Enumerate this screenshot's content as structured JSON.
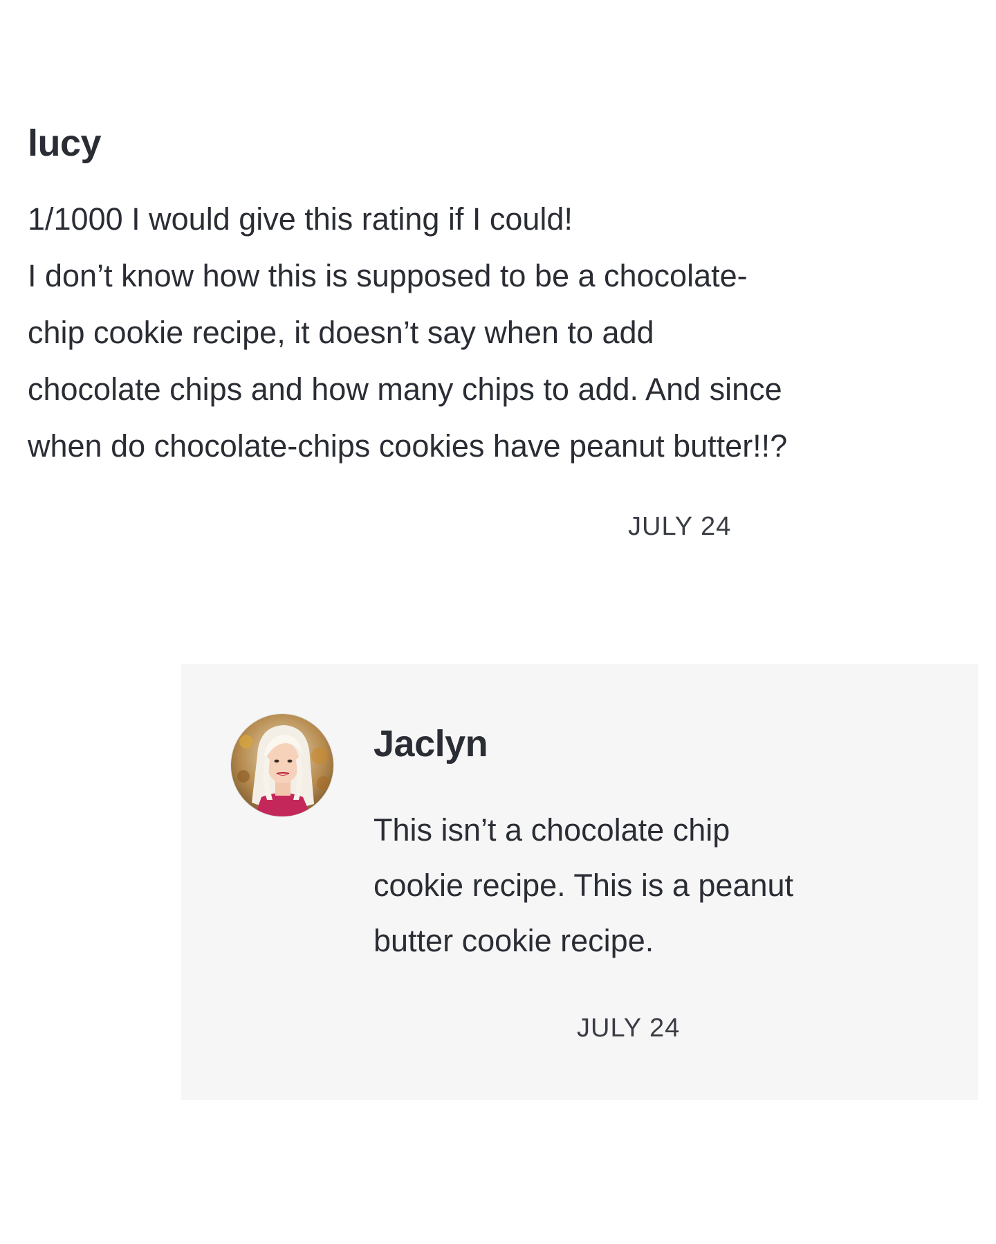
{
  "comment": {
    "author": "lucy",
    "lines": [
      "1/1000 I would give this rating if I could!",
      "I don’t know how this is supposed to be a chocolate-",
      "chip cookie recipe, it doesn’t say when to add",
      "chocolate chips and how many chips to add. And since",
      "when do chocolate-chips cookies have peanut butter!!?"
    ],
    "date": "JULY 24"
  },
  "reply": {
    "author": "Jaclyn",
    "avatar_icon": "user-avatar-photo",
    "lines": [
      "This isn’t a chocolate chip",
      "cookie recipe. This is a peanut",
      "butter cookie recipe."
    ],
    "date": "JULY 24"
  }
}
